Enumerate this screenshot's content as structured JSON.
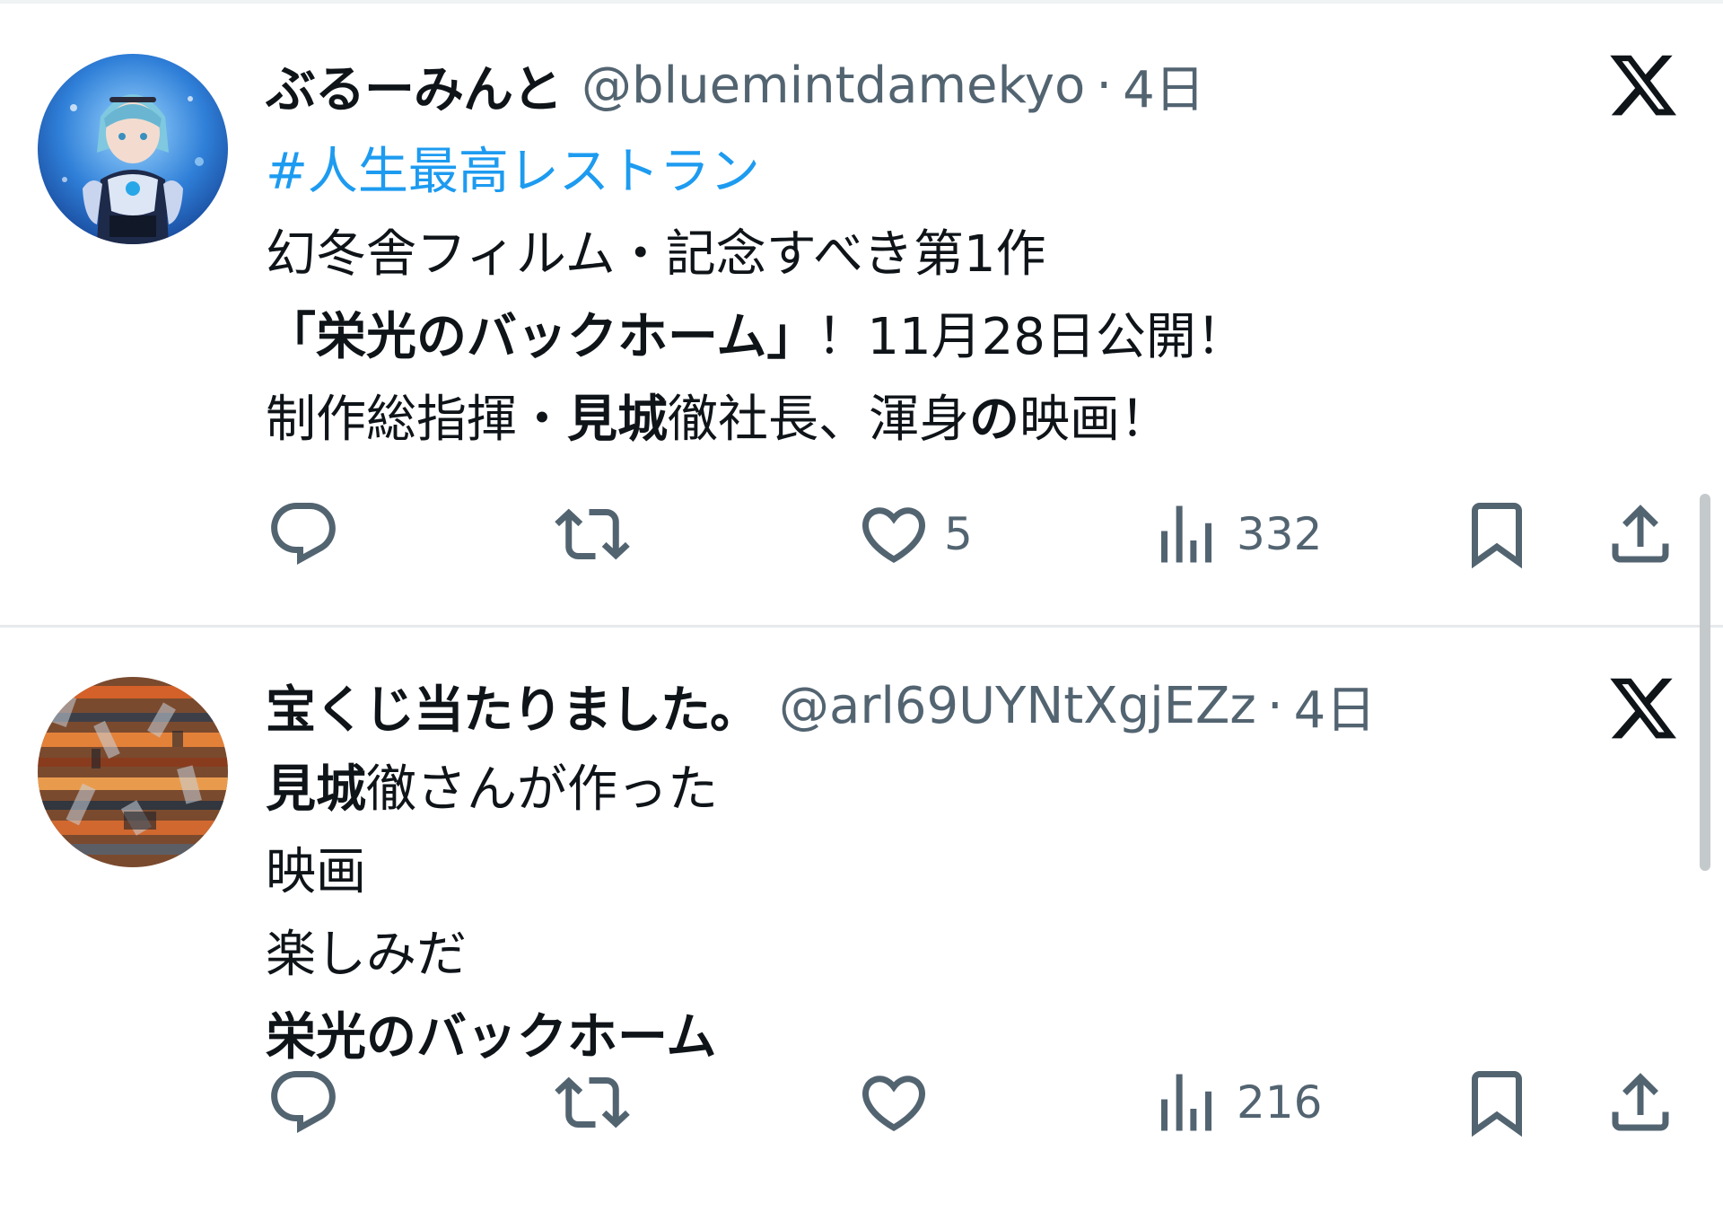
{
  "tweets": [
    {
      "author": {
        "display_name": "ぶるーみんと",
        "handle": "@bluemintdamekyo"
      },
      "separator": "·",
      "time": "4日",
      "avatar_icon": "anime-character-avatar",
      "lines": [
        [
          {
            "text": "#人生最高レストラン",
            "style": "hashtag"
          }
        ],
        [
          {
            "text": "幻冬舎フィルム・記念すべき第1作",
            "style": "normal"
          }
        ],
        [
          {
            "text": "「栄光のバックホーム」",
            "style": "bold"
          },
          {
            "text": "！11月28日公開！",
            "style": "normal"
          }
        ],
        [
          {
            "text": "制作総指揮・",
            "style": "normal"
          },
          {
            "text": "見城",
            "style": "bold"
          },
          {
            "text": "徹社長、渾身",
            "style": "normal"
          },
          {
            "text": "の",
            "style": "bold"
          },
          {
            "text": "映画！",
            "style": "normal"
          }
        ]
      ],
      "stats": {
        "reply": "",
        "retweet": "",
        "like": "5",
        "views": "332"
      }
    },
    {
      "author": {
        "display_name": "宝くじ当たりました。",
        "handle": "@arl69UYNtXgjEZz"
      },
      "separator": "·",
      "time": "4日",
      "avatar_icon": "abstract-pattern-avatar",
      "lines": [
        [
          {
            "text": "見城",
            "style": "bold"
          },
          {
            "text": "徹さんが作った",
            "style": "normal"
          }
        ],
        [
          {
            "text": "映画",
            "style": "normal"
          }
        ],
        [
          {
            "text": "楽しみだ",
            "style": "normal"
          }
        ],
        [
          {
            "text": "栄光のバックホーム",
            "style": "bold"
          }
        ]
      ],
      "stats": {
        "reply": "",
        "retweet": "",
        "like": "",
        "views": "216"
      }
    }
  ],
  "icons": {
    "platform": "x-logo-icon",
    "reply": "reply-icon",
    "retweet": "retweet-icon",
    "like": "heart-icon",
    "views": "views-chart-icon",
    "bookmark": "bookmark-icon",
    "share": "share-icon"
  },
  "colors": {
    "text": "#0f1419",
    "secondary": "#536471",
    "link": "#1d9bf0",
    "divider": "#e6eaec"
  }
}
